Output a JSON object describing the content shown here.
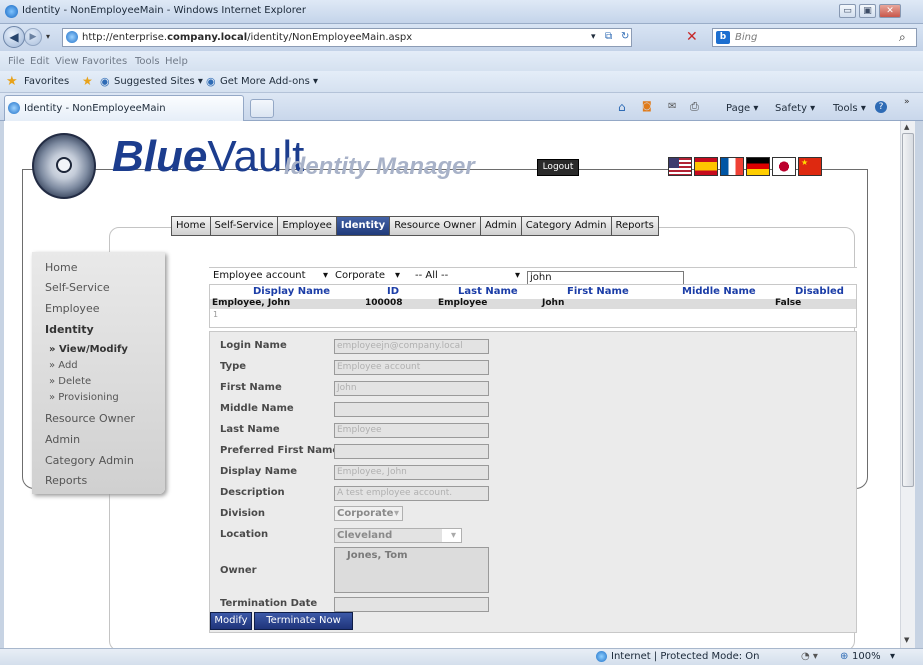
{
  "browser": {
    "window_title": "Identity - NonEmployeeMain - Windows Internet Explorer",
    "url_prefix": "http://enterprise.",
    "url_domain": "company.local",
    "url_path": "/identity/NonEmployeeMain.aspx",
    "search_placeholder": "Bing",
    "menu": [
      "File",
      "Edit",
      "View",
      "Favorites",
      "Tools",
      "Help"
    ],
    "favorites_label": "Favorites",
    "suggested_sites": "Suggested Sites ▾",
    "get_addons": "Get More Add-ons ▾",
    "tab_title": "Identity - NonEmployeeMain",
    "cmd_page": "Page ▾",
    "cmd_safety": "Safety ▾",
    "cmd_tools": "Tools ▾",
    "status_zone": "Internet | Protected Mode: On",
    "zoom": "100%"
  },
  "header": {
    "brand_bold": "Blue",
    "brand_light": "Vault",
    "subtitle": "Identity Manager",
    "logout": "Logout"
  },
  "nav_tabs": [
    "Home",
    "Self-Service",
    "Employee",
    "Identity",
    "Resource Owner",
    "Admin",
    "Category Admin",
    "Reports"
  ],
  "active_tab": "Identity",
  "sidebar": {
    "items": [
      "Home",
      "Self-Service",
      "Employee",
      "Identity",
      "Resource Owner",
      "Admin",
      "Category Admin",
      "Reports"
    ],
    "sub_items": [
      "» View/Modify",
      "» Add",
      "» Delete",
      "» Provisioning"
    ]
  },
  "search": {
    "type_value": "Employee account",
    "division_value": "Corporate",
    "filter_value": "-- All --",
    "query": "john"
  },
  "results": {
    "columns": [
      "Display Name",
      "ID",
      "Last Name",
      "First Name",
      "Middle Name",
      "Disabled"
    ],
    "rows": [
      {
        "display_name": "Employee, John",
        "id": "100008",
        "last_name": "Employee",
        "first_name": "John",
        "middle_name": "",
        "disabled": "False"
      }
    ],
    "pager": "1"
  },
  "form": {
    "labels": {
      "login": "Login Name",
      "type": "Type",
      "first": "First Name",
      "middle": "Middle Name",
      "last": "Last Name",
      "preferred": "Preferred First Name",
      "display": "Display Name",
      "description": "Description",
      "division": "Division",
      "location": "Location",
      "owner": "Owner",
      "termination": "Termination Date"
    },
    "values": {
      "login": "employeejn@company.local",
      "type": "Employee account",
      "first": "John",
      "middle": "",
      "last": "Employee",
      "preferred": "",
      "display": "Employee, John",
      "description": "A test employee account.",
      "division": "Corporate",
      "location": "Cleveland",
      "owner": "Jones, Tom",
      "termination": ""
    },
    "modify": "Modify",
    "terminate": "Terminate Now"
  },
  "colors": {
    "brand_blue": "#1c3d8e",
    "active_tab": "#203a7a",
    "header_link": "#1b3da7"
  }
}
